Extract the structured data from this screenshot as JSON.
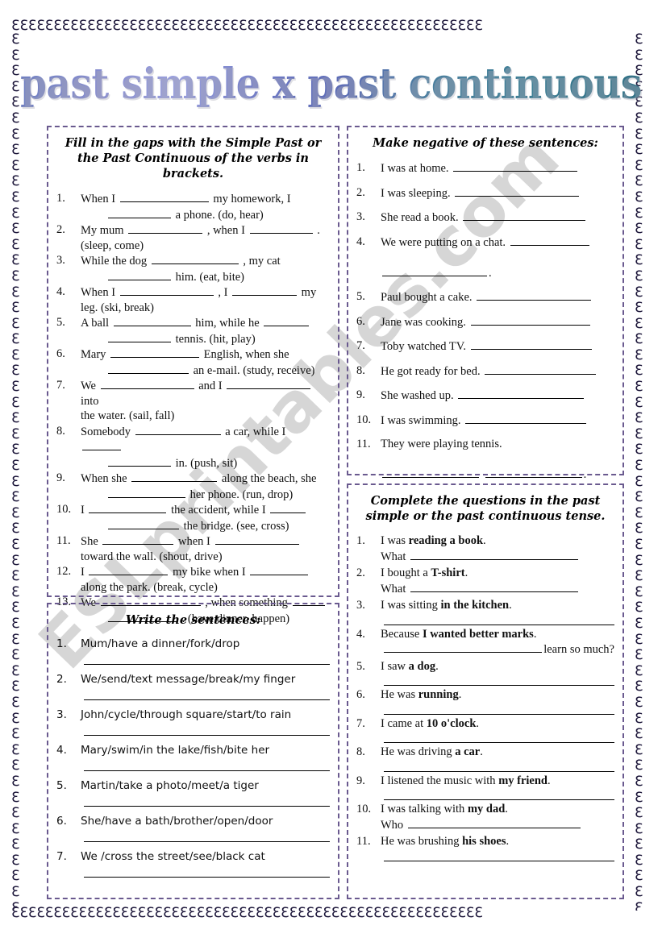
{
  "page": {
    "title": "past simple x past continuous",
    "watermark": "ESLprintables.com",
    "border_glyph": "ℇ",
    "colors": {
      "box_border": "#6a5a8f",
      "title_start": "#6f7fc0",
      "title_end": "#2f6f84",
      "watermark": "#c9c9c9",
      "text": "#111111"
    }
  },
  "exercises": {
    "fill_gaps": {
      "title": "Fill in the gaps with the Simple Past or the Past Continuous of the verbs in brackets.",
      "items": [
        {
          "num": "1.",
          "line1_a": "When I",
          "gap1": 110,
          "line1_b": "my homework, I",
          "line2_gap": 78,
          "line2_b": "a phone. (do, hear)"
        },
        {
          "num": "2.",
          "line1_a": "My mum",
          "gap1": 92,
          "line1_b": ", when I",
          "gap2": 78,
          "line1_c": ".",
          "line2_b": "(sleep, come)"
        },
        {
          "num": "3.",
          "line1_a": "While the dog",
          "gap1": 108,
          "line1_b": ", my cat",
          "line2_gap": 78,
          "line2_b": "him. (eat, bite)"
        },
        {
          "num": "4.",
          "line1_a": "When I",
          "gap1": 116,
          "line1_b": ", I",
          "gap2": 80,
          "line1_c": "my",
          "line2_b": "leg. (ski, break)"
        },
        {
          "num": "5.",
          "line1_a": "A ball",
          "gap1": 96,
          "line1_b": "him, while he",
          "gap2": 56,
          "line2_gap": 78,
          "line2_b": "tennis. (hit, play)"
        },
        {
          "num": "6.",
          "line1_a": "Mary",
          "gap1": 110,
          "line1_b": "English, when she",
          "line2_gap": 100,
          "line2_b": "an e-mail. (study, receive)"
        },
        {
          "num": "7.",
          "line1_a": "We",
          "gap1": 116,
          "line1_b": "and I",
          "gap2": 104,
          "line1_c": "into",
          "line2_b": "the water. (sail, fall)"
        },
        {
          "num": "8.",
          "line1_a": "Somebody",
          "gap1": 106,
          "line1_b": "a car, while I",
          "gap2": 48,
          "line2_gap": 78,
          "line2_b": "in. (push, sit)"
        },
        {
          "num": "9.",
          "line1_a": "When she",
          "gap1": 106,
          "line1_b": "along the beach, she",
          "line2_gap": 96,
          "line2_b": "her phone. (run, drop)"
        },
        {
          "num": "10.",
          "line1_a": "I",
          "gap1": 96,
          "line1_b": "the accident, while I",
          "gap2": 44,
          "line2_gap": 88,
          "line2_b": "the bridge. (see, cross)"
        },
        {
          "num": "11.",
          "line1_a": "She",
          "gap1": 88,
          "line1_b": "when I",
          "gap2": 104,
          "line2_b": "toward the wall. (shout, drive)"
        },
        {
          "num": "12.",
          "line1_a": "I",
          "gap1": 98,
          "line1_b": "my bike when I",
          "gap2": 72,
          "line2_b": "along the park. (break, cycle)"
        },
        {
          "num": "13.",
          "line1_a": "We",
          "gap1": 124,
          "line1_b": ", when something",
          "gap2": 40,
          "line2_gap": 86,
          "line2_b": ". (have dinner, happen)"
        }
      ]
    },
    "negatives": {
      "title": "Make negative of these sentences:",
      "items": [
        {
          "num": "1.",
          "text": "I was at home.",
          "gap": 154
        },
        {
          "num": "2.",
          "text": "I was sleeping.",
          "gap": 154
        },
        {
          "num": "3.",
          "text": "She read a book.",
          "gap": 152
        },
        {
          "num": "4.",
          "text": "We were putting on a chat.",
          "gap": 98,
          "second_gap": 130,
          "second_tail": "."
        },
        {
          "num": "5.",
          "text": "Paul bought a cake.",
          "gap": 142
        },
        {
          "num": "6.",
          "text": "Jane was cooking.",
          "gap": 148
        },
        {
          "num": "7.",
          "text": "Toby watched TV.",
          "gap": 150
        },
        {
          "num": "8.",
          "text": "He got ready for bed.",
          "gap": 138
        },
        {
          "num": "9.",
          "text": "She washed up.",
          "gap": 156
        },
        {
          "num": "10.",
          "text": "I was swimming.",
          "gap": 150
        },
        {
          "num": "11.",
          "text": "They were playing tennis.",
          "second_gap_a": 120,
          "second_gap_b": 120,
          "second_tail": "."
        }
      ]
    },
    "write_sentences": {
      "title": "Write the sentences:",
      "items": [
        {
          "num": "1.",
          "text": "Mum/have a dinner/fork/drop"
        },
        {
          "num": "2.",
          "text": "We/send/text message/break/my finger"
        },
        {
          "num": "3.",
          "text": "John/cycle/through square/start/to rain"
        },
        {
          "num": "4.",
          "text": "Mary/swim/in the lake/fish/bite her"
        },
        {
          "num": "5.",
          "text": "Martin/take a photo/meet/a tiger"
        },
        {
          "num": "6.",
          "text": "She/have a bath/brother/open/door"
        },
        {
          "num": "7.",
          "text": "We /cross the street/see/black cat"
        }
      ]
    },
    "questions": {
      "title": "Complete the questions in the past simple or the past continuous tense.",
      "items": [
        {
          "num": "1.",
          "pre": "I was ",
          "bold": "reading a book",
          "post": ".",
          "prompt": "What",
          "prompt_gap": 208
        },
        {
          "num": "2.",
          "pre": "I bought a ",
          "bold": "T-shirt",
          "post": ".",
          "prompt": "What",
          "prompt_gap": 208
        },
        {
          "num": "3.",
          "pre": "I was sitting ",
          "bold": "in the kitchen",
          "post": ".",
          "rule": true
        },
        {
          "num": "4.",
          "pre": "Because ",
          "bold": "I wanted better marks",
          "post": ".",
          "tail_gap": 196,
          "tail": "learn so much?"
        },
        {
          "num": "5.",
          "pre": "I saw ",
          "bold": "a dog",
          "post": ".",
          "rule": true
        },
        {
          "num": "6.",
          "pre": "He was ",
          "bold": "running",
          "post": ".",
          "rule": true
        },
        {
          "num": "7.",
          "pre": "I came at ",
          "bold": "10 o'clock",
          "post": ".",
          "rule": true
        },
        {
          "num": "8.",
          "pre": "He was driving ",
          "bold": "a car",
          "post": ".",
          "rule": true
        },
        {
          "num": "9.",
          "pre": " I listened the music with ",
          "bold": "my friend",
          "post": ".",
          "rule": true
        },
        {
          "num": "10.",
          "pre": "I was talking with ",
          "bold": "my dad",
          "post": ".",
          "prompt": "Who",
          "prompt_gap": 214
        },
        {
          "num": "11.",
          "pre": "He was brushing ",
          "bold": "his shoes",
          "post": ".",
          "rule": true
        }
      ]
    }
  }
}
